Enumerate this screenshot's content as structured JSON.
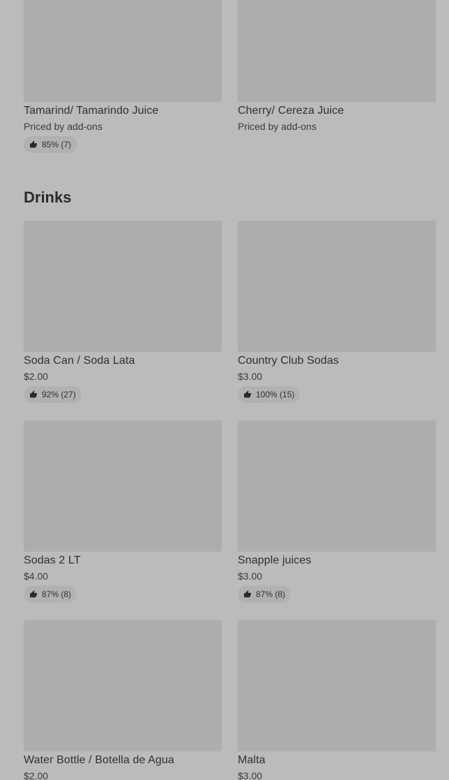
{
  "top_items": [
    {
      "name": "Tamarind/ Tamarindo Juice",
      "price": "Priced by add-ons",
      "rating": "85% (7)"
    },
    {
      "name": "Cherry/ Cereza Juice",
      "price": "Priced by add-ons",
      "rating": ""
    }
  ],
  "section": {
    "title": "Drinks"
  },
  "drinks": [
    {
      "name": "Soda Can / Soda Lata",
      "price": "$2.00",
      "rating": "92% (27)"
    },
    {
      "name": "Country Club Sodas",
      "price": "$3.00",
      "rating": "100% (15)"
    },
    {
      "name": "Sodas 2 LT",
      "price": "$4.00",
      "rating": "87% (8)"
    },
    {
      "name": "Snapple juices",
      "price": "$3.00",
      "rating": "87% (8)"
    },
    {
      "name": "Water Bottle / Botella de Agua",
      "price": "$2.00",
      "rating": ""
    },
    {
      "name": "Malta",
      "price": "$3.00",
      "rating": ""
    }
  ],
  "icons": {
    "rating": "thumbs-up-icon"
  }
}
